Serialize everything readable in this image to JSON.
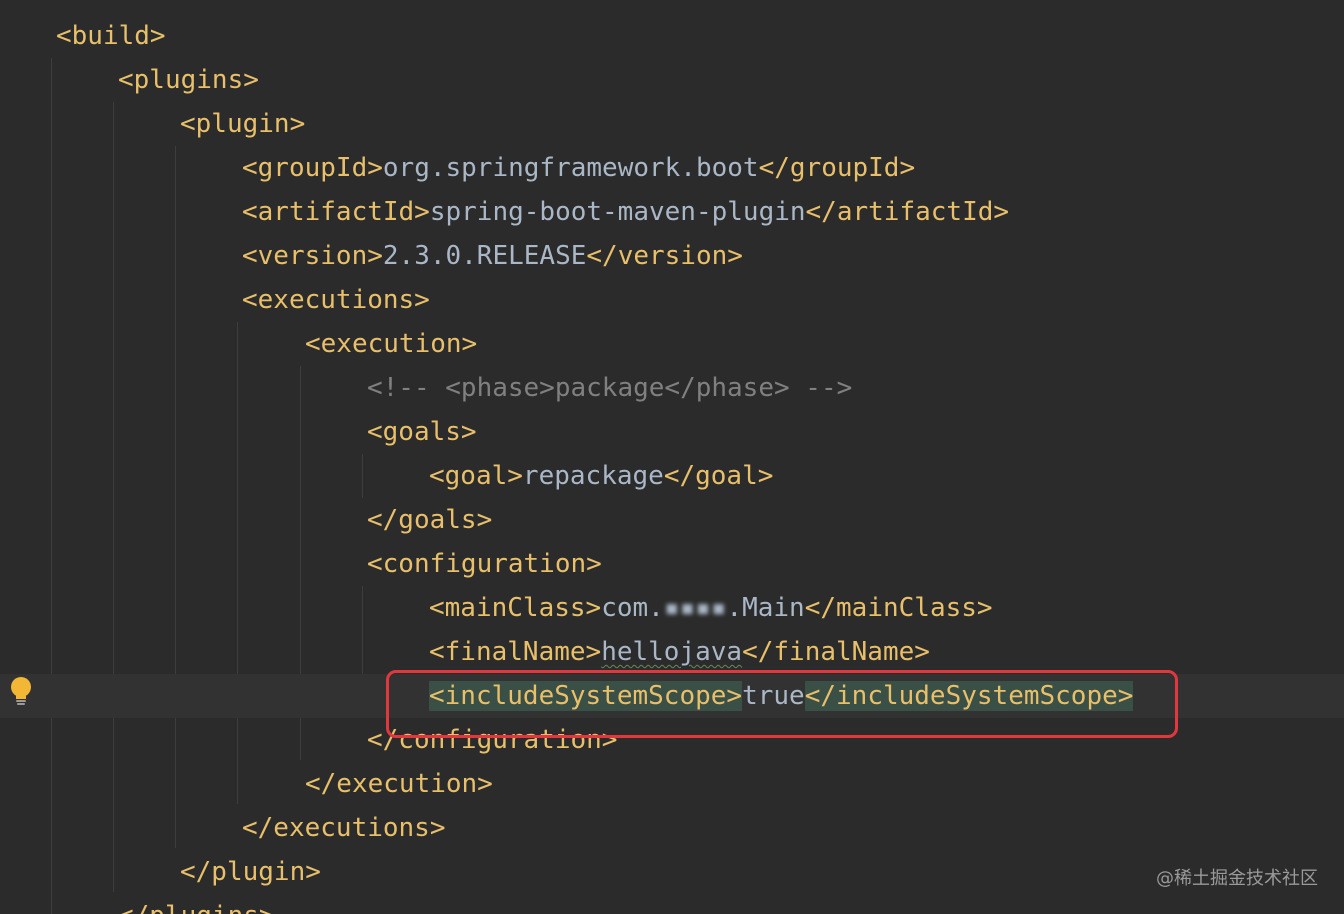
{
  "lines": [
    {
      "open": "<build>"
    },
    {
      "open": "<plugins>"
    },
    {
      "open": "<plugin>"
    },
    {
      "open": "<groupId>",
      "text": "org.springframework.boot",
      "close": "</groupId>"
    },
    {
      "open": "<artifactId>",
      "text": "spring-boot-maven-plugin",
      "close": "</artifactId>"
    },
    {
      "open": "<version>",
      "text": "2.3.0.RELEASE",
      "close": "</version>"
    },
    {
      "open": "<executions>"
    },
    {
      "open": "<execution>"
    },
    {
      "comment": "<!-- <phase>package</phase> -->"
    },
    {
      "open": "<goals>"
    },
    {
      "open": "<goal>",
      "text": "repackage",
      "close": "</goal>"
    },
    {
      "close": "</goals>"
    },
    {
      "open": "<configuration>"
    },
    {
      "open": "<mainClass>",
      "text_prefix": "com.",
      "text_redacted": "▪▪▪▪",
      "text_suffix": ".Main",
      "close": "</mainClass>"
    },
    {
      "open": "<finalName>",
      "text": "hellojava",
      "close": "</finalName>"
    },
    {
      "open": "<includeSystemScope>",
      "text": "true",
      "close": "</includeSystemScope>"
    },
    {
      "close": "</configuration>"
    },
    {
      "close": "</execution>"
    },
    {
      "close": "</executions>"
    },
    {
      "close": "</plugin>"
    },
    {
      "close": "</plugins>"
    }
  ],
  "gutter": {
    "icon": "lightbulb-icon",
    "color": "#f2b735"
  },
  "highlight_box_color": "#e0383e",
  "watermark": "@稀土掘金技术社区",
  "colors": {
    "background": "#2b2b2b",
    "tag": "#e8bf6a",
    "text": "#a9b7c6",
    "comment": "#808080"
  }
}
